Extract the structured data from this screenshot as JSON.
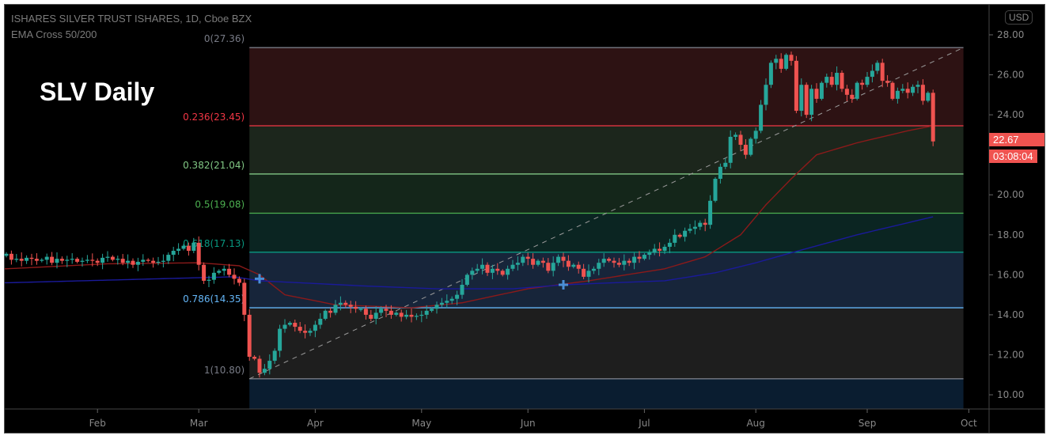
{
  "header": {
    "symbol_line": "ISHARES SILVER TRUST ISHARES, 1D, Cboe BZX",
    "indicator_line": "EMA Cross 50/200",
    "title": "SLV Daily",
    "currency": "USD"
  },
  "price_tags": {
    "last_price": "22.67",
    "countdown": "03:08:04"
  },
  "chart_data": {
    "type": "candlestick",
    "title": "SLV Daily",
    "ylim": [
      9.5,
      29.5
    ],
    "y_ticks": [
      "28.00",
      "26.00",
      "24.00",
      "22.00",
      "20.00",
      "18.00",
      "16.00",
      "14.00",
      "12.00",
      "10.00"
    ],
    "y_tick_values": [
      28,
      26,
      24,
      22,
      20,
      18,
      16,
      14,
      12,
      10
    ],
    "x_ticks": [
      {
        "label": "Feb",
        "index": 18
      },
      {
        "label": "Mar",
        "index": 38
      },
      {
        "label": "Apr",
        "index": 61
      },
      {
        "label": "May",
        "index": 82
      },
      {
        "label": "Jun",
        "index": 103
      },
      {
        "label": "Jul",
        "index": 126
      },
      {
        "label": "Aug",
        "index": 148
      },
      {
        "label": "Sep",
        "index": 170
      },
      {
        "label": "Oct",
        "index": 191
      }
    ],
    "closes": [
      17.05,
      16.75,
      16.8,
      16.7,
      16.85,
      16.8,
      16.7,
      16.75,
      16.9,
      16.6,
      16.8,
      16.7,
      16.75,
      16.8,
      16.65,
      16.7,
      16.75,
      16.7,
      16.6,
      16.85,
      16.9,
      16.75,
      16.8,
      16.6,
      16.7,
      16.5,
      16.65,
      16.75,
      16.7,
      16.6,
      16.65,
      16.7,
      17.0,
      17.2,
      17.3,
      17.45,
      17.2,
      17.6,
      16.5,
      15.7,
      15.75,
      16.1,
      16.2,
      16.3,
      16.0,
      15.8,
      15.6,
      14.0,
      11.9,
      11.8,
      11.1,
      11.3,
      11.7,
      12.2,
      13.3,
      13.5,
      13.6,
      13.4,
      13.2,
      13.1,
      13.2,
      13.5,
      13.8,
      14.2,
      14.1,
      14.5,
      14.6,
      14.5,
      14.4,
      14.3,
      14.3,
      14.0,
      13.8,
      14.1,
      14.3,
      14.2,
      14.0,
      14.1,
      13.9,
      14.0,
      13.9,
      13.95,
      14.0,
      14.2,
      14.3,
      14.5,
      14.6,
      14.7,
      14.8,
      15.0,
      15.5,
      16.0,
      16.2,
      16.3,
      16.5,
      16.1,
      16.3,
      16.2,
      16.0,
      16.3,
      16.5,
      16.6,
      16.9,
      16.8,
      16.5,
      16.7,
      16.6,
      16.2,
      16.6,
      16.9,
      16.7,
      16.4,
      16.5,
      16.3,
      15.9,
      16.2,
      16.3,
      16.6,
      16.8,
      16.7,
      16.6,
      16.5,
      16.7,
      16.6,
      16.9,
      16.8,
      17.0,
      17.1,
      17.3,
      17.2,
      17.4,
      17.6,
      18.0,
      17.9,
      18.2,
      18.3,
      18.4,
      18.6,
      18.5,
      19.7,
      20.8,
      21.4,
      21.6,
      22.9,
      23.0,
      22.5,
      22.0,
      22.8,
      23.2,
      24.5,
      25.5,
      26.6,
      26.8,
      26.3,
      27.0,
      26.7,
      24.2,
      25.5,
      24.0,
      25.3,
      24.8,
      25.6,
      25.9,
      25.5,
      26.1,
      25.3,
      25.0,
      24.8,
      25.6,
      25.5,
      25.9,
      26.2,
      26.6,
      25.7,
      25.6,
      24.8,
      25.2,
      25.3,
      25.1,
      25.4,
      25.5,
      24.7,
      25.1,
      22.67
    ],
    "ema50": [
      [
        0,
        16.3
      ],
      [
        20,
        16.55
      ],
      [
        38,
        16.6
      ],
      [
        46,
        16.45
      ],
      [
        50,
        16.0
      ],
      [
        55,
        15.0
      ],
      [
        65,
        14.5
      ],
      [
        80,
        14.35
      ],
      [
        90,
        14.6
      ],
      [
        103,
        15.3
      ],
      [
        115,
        15.7
      ],
      [
        130,
        16.3
      ],
      [
        138,
        16.9
      ],
      [
        145,
        18.0
      ],
      [
        150,
        19.5
      ],
      [
        155,
        20.8
      ],
      [
        160,
        22.0
      ],
      [
        168,
        22.6
      ],
      [
        178,
        23.2
      ],
      [
        183,
        23.45
      ]
    ],
    "ema200": [
      [
        0,
        15.6
      ],
      [
        30,
        15.8
      ],
      [
        45,
        15.9
      ],
      [
        50,
        15.7
      ],
      [
        70,
        15.45
      ],
      [
        85,
        15.3
      ],
      [
        100,
        15.3
      ],
      [
        110,
        15.5
      ],
      [
        130,
        15.7
      ],
      [
        140,
        16.1
      ],
      [
        148,
        16.6
      ],
      [
        155,
        17.1
      ],
      [
        168,
        18.0
      ],
      [
        183,
        18.9
      ]
    ],
    "cross_markers": [
      [
        50,
        15.8
      ],
      [
        110,
        15.5
      ]
    ],
    "fib": {
      "start_index": 48,
      "end_index": 189,
      "levels": [
        {
          "label": "0(27.36)",
          "price": 27.36,
          "color": "#787b86",
          "fill": "#2d1213"
        },
        {
          "label": "0.236(23.45)",
          "price": 23.45,
          "color": "#f23645",
          "fill": "#1c261c"
        },
        {
          "label": "0.382(21.04)",
          "price": 21.04,
          "color": "#81c784",
          "fill": "#14261a"
        },
        {
          "label": "0.5(19.08)",
          "price": 19.08,
          "color": "#4caf50",
          "fill": "#0b2522"
        },
        {
          "label": "0.618(17.13)",
          "price": 17.13,
          "color": "#089981",
          "fill": "#17253a"
        },
        {
          "label": "0.786(14.35)",
          "price": 14.35,
          "color": "#64b5f6",
          "fill": "#1e1e1e"
        },
        {
          "label": "1(10.80)",
          "price": 10.8,
          "color": "#787b86",
          "fill": "#0a1d30"
        }
      ]
    },
    "colors": {
      "up": "#26a69a",
      "down": "#ef5350",
      "ema50": "#8b1a1a",
      "ema200": "#1a1a9a"
    }
  }
}
